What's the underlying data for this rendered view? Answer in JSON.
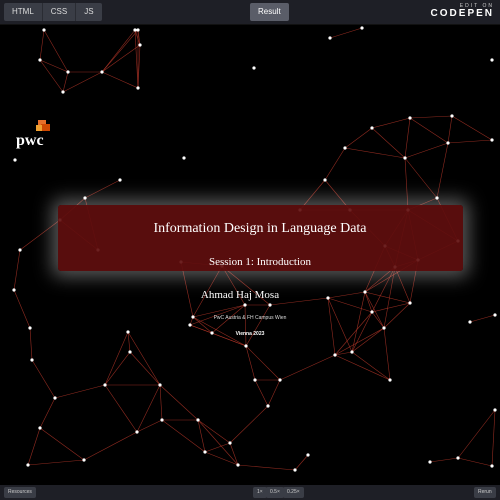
{
  "toolbar": {
    "tabs": [
      "HTML",
      "CSS",
      "JS"
    ],
    "result_label": "Result",
    "edit_on_small": "EDIT ON",
    "brand": "CODEPEN"
  },
  "slide": {
    "logo_text": "pwc",
    "title": "Information Design in Language Data",
    "session": "Session 1: Introduction",
    "author": "Ahmad Haj Mosa",
    "affiliation": "PwC Austria & FH Campus Wien",
    "location": "Vienna 2023"
  },
  "bottom": {
    "resources_label": "Resources",
    "zoom_options": [
      "1×",
      "0.5×",
      "0.25×"
    ],
    "rerun_label": "Rerun"
  },
  "colors": {
    "background": "#000000",
    "link": "#c0392b",
    "node": "#ffffff",
    "title_box": "#5f0e0e",
    "logo_orange": "#e8702a",
    "logo_red": "#d04a02"
  }
}
